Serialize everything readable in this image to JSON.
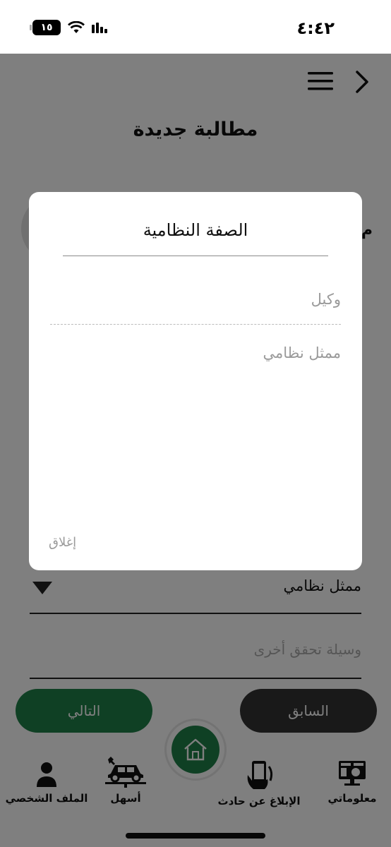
{
  "status_bar": {
    "time": "٤:٤٢",
    "battery": "١٥"
  },
  "header": {
    "title": "مطالبة جديدة",
    "partial_label": "م"
  },
  "form": {
    "legal_status_value": "ممثل نظامي",
    "other_verification_placeholder": "وسيلة تحقق أخرى"
  },
  "buttons": {
    "next": "التالي",
    "previous": "السابق"
  },
  "bottom_nav": {
    "items": [
      {
        "label": "الملف الشخصي",
        "icon": "person-icon"
      },
      {
        "label": "أسهل",
        "icon": "car-lift-icon"
      },
      {
        "label": "الإبلاغ عن حادث",
        "icon": "phone-hand-icon"
      },
      {
        "label": "معلوماتي",
        "icon": "monitor-icon"
      }
    ],
    "home_icon": "home-icon"
  },
  "modal": {
    "title": "الصفة النظامية",
    "options": [
      "وكيل",
      "ممثل نظامي"
    ],
    "close_label": "إغلاق"
  },
  "colors": {
    "primary_green": "#1f8048",
    "dark_button": "#333333",
    "overlay": "rgba(0,0,0,0.5)"
  }
}
